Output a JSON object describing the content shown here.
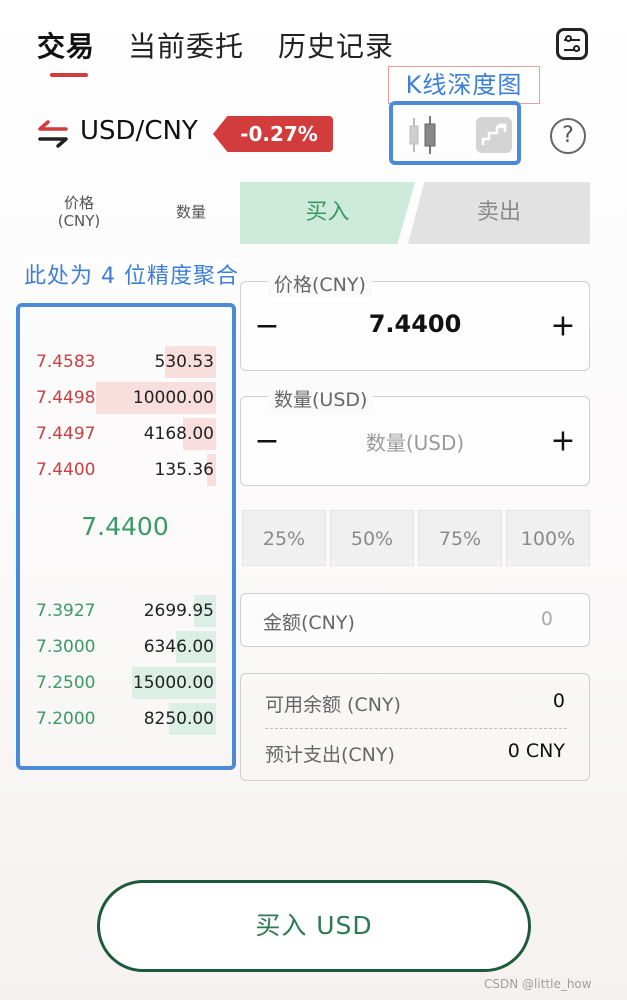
{
  "tabs": [
    {
      "label": "交易",
      "active": true
    },
    {
      "label": "当前委托",
      "active": false
    },
    {
      "label": "历史记录",
      "active": false
    }
  ],
  "annotations": {
    "kline_label": "K线深度图",
    "aggregation_label": "此处为 4 位精度聚合"
  },
  "pair": {
    "symbol": "USD/CNY",
    "change": "-0.27%",
    "change_color": "#d23c3c"
  },
  "icons": {
    "swap": "swap-arrows-icon",
    "candlestick": "candlestick-icon",
    "depth": "depth-chart-icon",
    "help": "help-icon",
    "help_glyph": "?",
    "settings": "settings-sliders-icon"
  },
  "orderbook": {
    "header_price": "价格",
    "header_price_unit": "(CNY)",
    "header_qty": "数量",
    "asks": [
      {
        "price": "7.4583",
        "qty": "530.53",
        "depth": 0.28
      },
      {
        "price": "7.4498",
        "qty": "10000.00",
        "depth": 0.66
      },
      {
        "price": "7.4497",
        "qty": "4168.00",
        "depth": 0.18
      },
      {
        "price": "7.4400",
        "qty": "135.36",
        "depth": 0.05
      }
    ],
    "mid": "7.4400",
    "bids": [
      {
        "price": "7.3927",
        "qty": "2699.95",
        "depth": 0.12
      },
      {
        "price": "7.3000",
        "qty": "6346.00",
        "depth": 0.22
      },
      {
        "price": "7.2500",
        "qty": "15000.00",
        "depth": 0.46
      },
      {
        "price": "7.2000",
        "qty": "8250.00",
        "depth": 0.26
      }
    ]
  },
  "side_tabs": {
    "buy": "买入",
    "sell": "卖出",
    "buy_color": "#3a9a66",
    "sell_color": "#8a8a8a"
  },
  "form": {
    "price": {
      "legend": "价格(CNY)",
      "value": "7.4400",
      "minus": "−",
      "plus": "+"
    },
    "quantity": {
      "legend": "数量(USD)",
      "placeholder": "数量(USD)",
      "minus": "−",
      "plus": "+"
    },
    "percent_options": [
      "25%",
      "50%",
      "75%",
      "100%"
    ],
    "amount": {
      "label": "金额(CNY)",
      "value": "0"
    },
    "available": {
      "label": "可用余额 (CNY)",
      "value": "0"
    },
    "estimated": {
      "label": "预计支出(CNY)",
      "value": "0 CNY"
    }
  },
  "submit_label": "买入 USD",
  "watermark": "CSDN @little_how"
}
